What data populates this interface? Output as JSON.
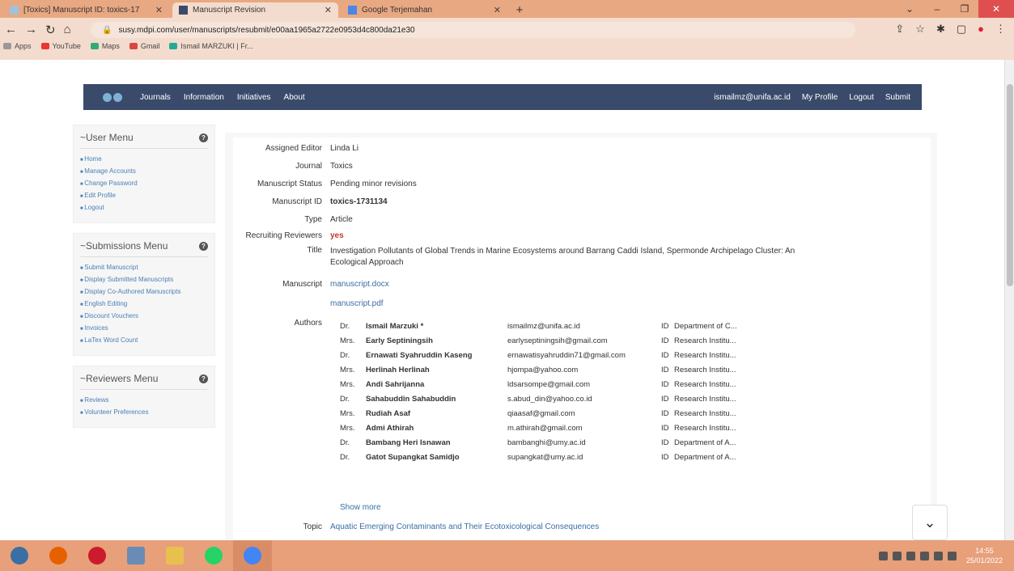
{
  "browser": {
    "tabs": [
      {
        "title": "[Toxics] Manuscript ID: toxics-17",
        "active": false
      },
      {
        "title": "Manuscript Revision",
        "active": true
      },
      {
        "title": "Google Terjemahan",
        "active": false
      }
    ],
    "url": "susy.mdpi.com/user/manuscripts/resubmit/e00aa1965a2722e0953d4c800da21e30",
    "bookmarks": [
      "Apps",
      "YouTube",
      "Maps",
      "Gmail",
      "Ismail MARZUKI | Fr..."
    ]
  },
  "topnav": {
    "menu": [
      "Journals",
      "Information",
      "Initiatives",
      "About"
    ],
    "right": [
      "ismailmz@unifa.ac.id",
      "My Profile",
      "Logout",
      "Submit"
    ]
  },
  "sidebar": {
    "user_menu": {
      "title": "User Menu",
      "items": [
        "Home",
        "Manage Accounts",
        "Change Password",
        "Edit Profile",
        "Logout"
      ]
    },
    "submissions_menu": {
      "title": "Submissions Menu",
      "items": [
        "Submit Manuscript",
        "Display Submitted Manuscripts",
        "Display Co-Authored Manuscripts",
        "English Editing",
        "Discount Vouchers",
        "Invoices",
        "LaTex Word Count"
      ]
    },
    "reviewers_menu": {
      "title": "Reviewers Menu",
      "items": [
        "Reviews",
        "Volunteer Preferences"
      ]
    }
  },
  "details": {
    "assigned_editor_label": "Assigned Editor",
    "assigned_editor": "Linda Li",
    "journal_label": "Journal",
    "journal": "Toxics",
    "status_label": "Manuscript Status",
    "status": "Pending minor revisions",
    "id_label": "Manuscript ID",
    "id": "toxics-1731134",
    "type_label": "Type",
    "type": "Article",
    "recruiting_label": "Recruiting Reviewers",
    "recruiting": "yes",
    "title_label": "Title",
    "title": "Investigation Pollutants of Global Trends in Marine Ecosystems around Barrang Caddi Island, Spermonde Archipelago Cluster: An Ecological Approach",
    "manuscript_label": "Manuscript",
    "manuscript_docx": "manuscript.docx",
    "manuscript_pdf": "manuscript.pdf",
    "authors_label": "Authors",
    "show_more": "Show more",
    "topic_label": "Topic",
    "topic": "Aquatic Emerging Contaminants and Their Ecotoxicological Consequences"
  },
  "authors": [
    {
      "title": "Dr.",
      "name": "Ismail Marzuki *",
      "email": "ismailmz@unifa.ac.id",
      "id": "ID",
      "dept": "Department of C..."
    },
    {
      "title": "Mrs.",
      "name": "Early Septiningsih",
      "email": "earlyseptiningsih@gmail.com",
      "id": "ID",
      "dept": "Research Institu..."
    },
    {
      "title": "Dr.",
      "name": "Ernawati Syahruddin Kaseng",
      "email": "ernawatisyahruddin71@gmail.com",
      "id": "ID",
      "dept": "Research Institu..."
    },
    {
      "title": "Mrs.",
      "name": "Herlinah Herlinah",
      "email": "hjompa@yahoo.com",
      "id": "ID",
      "dept": "Research Institu..."
    },
    {
      "title": "Mrs.",
      "name": "Andi Sahrijanna",
      "email": "ldsarsompe@gmail.com",
      "id": "ID",
      "dept": "Research Institu..."
    },
    {
      "title": "Dr.",
      "name": "Sahabuddin Sahabuddin",
      "email": "s.abud_din@yahoo.co.id",
      "id": "ID",
      "dept": "Research Institu..."
    },
    {
      "title": "Mrs.",
      "name": "Rudiah Asaf",
      "email": "qiaasaf@gmail.com",
      "id": "ID",
      "dept": "Research Institu..."
    },
    {
      "title": "Mrs.",
      "name": "Admi Athirah",
      "email": "m.athirah@gmail.com",
      "id": "ID",
      "dept": "Research Institu..."
    },
    {
      "title": "Dr.",
      "name": "Bambang Heri Isnawan",
      "email": "bambanghi@umy.ac.id",
      "id": "ID",
      "dept": "Department of A..."
    },
    {
      "title": "Dr.",
      "name": "Gatot Supangkat Samidjo",
      "email": "supangkat@umy.ac.id",
      "id": "ID",
      "dept": "Department of A..."
    }
  ],
  "taskbar": {
    "time": "14:55",
    "date": "25/01/2022"
  }
}
